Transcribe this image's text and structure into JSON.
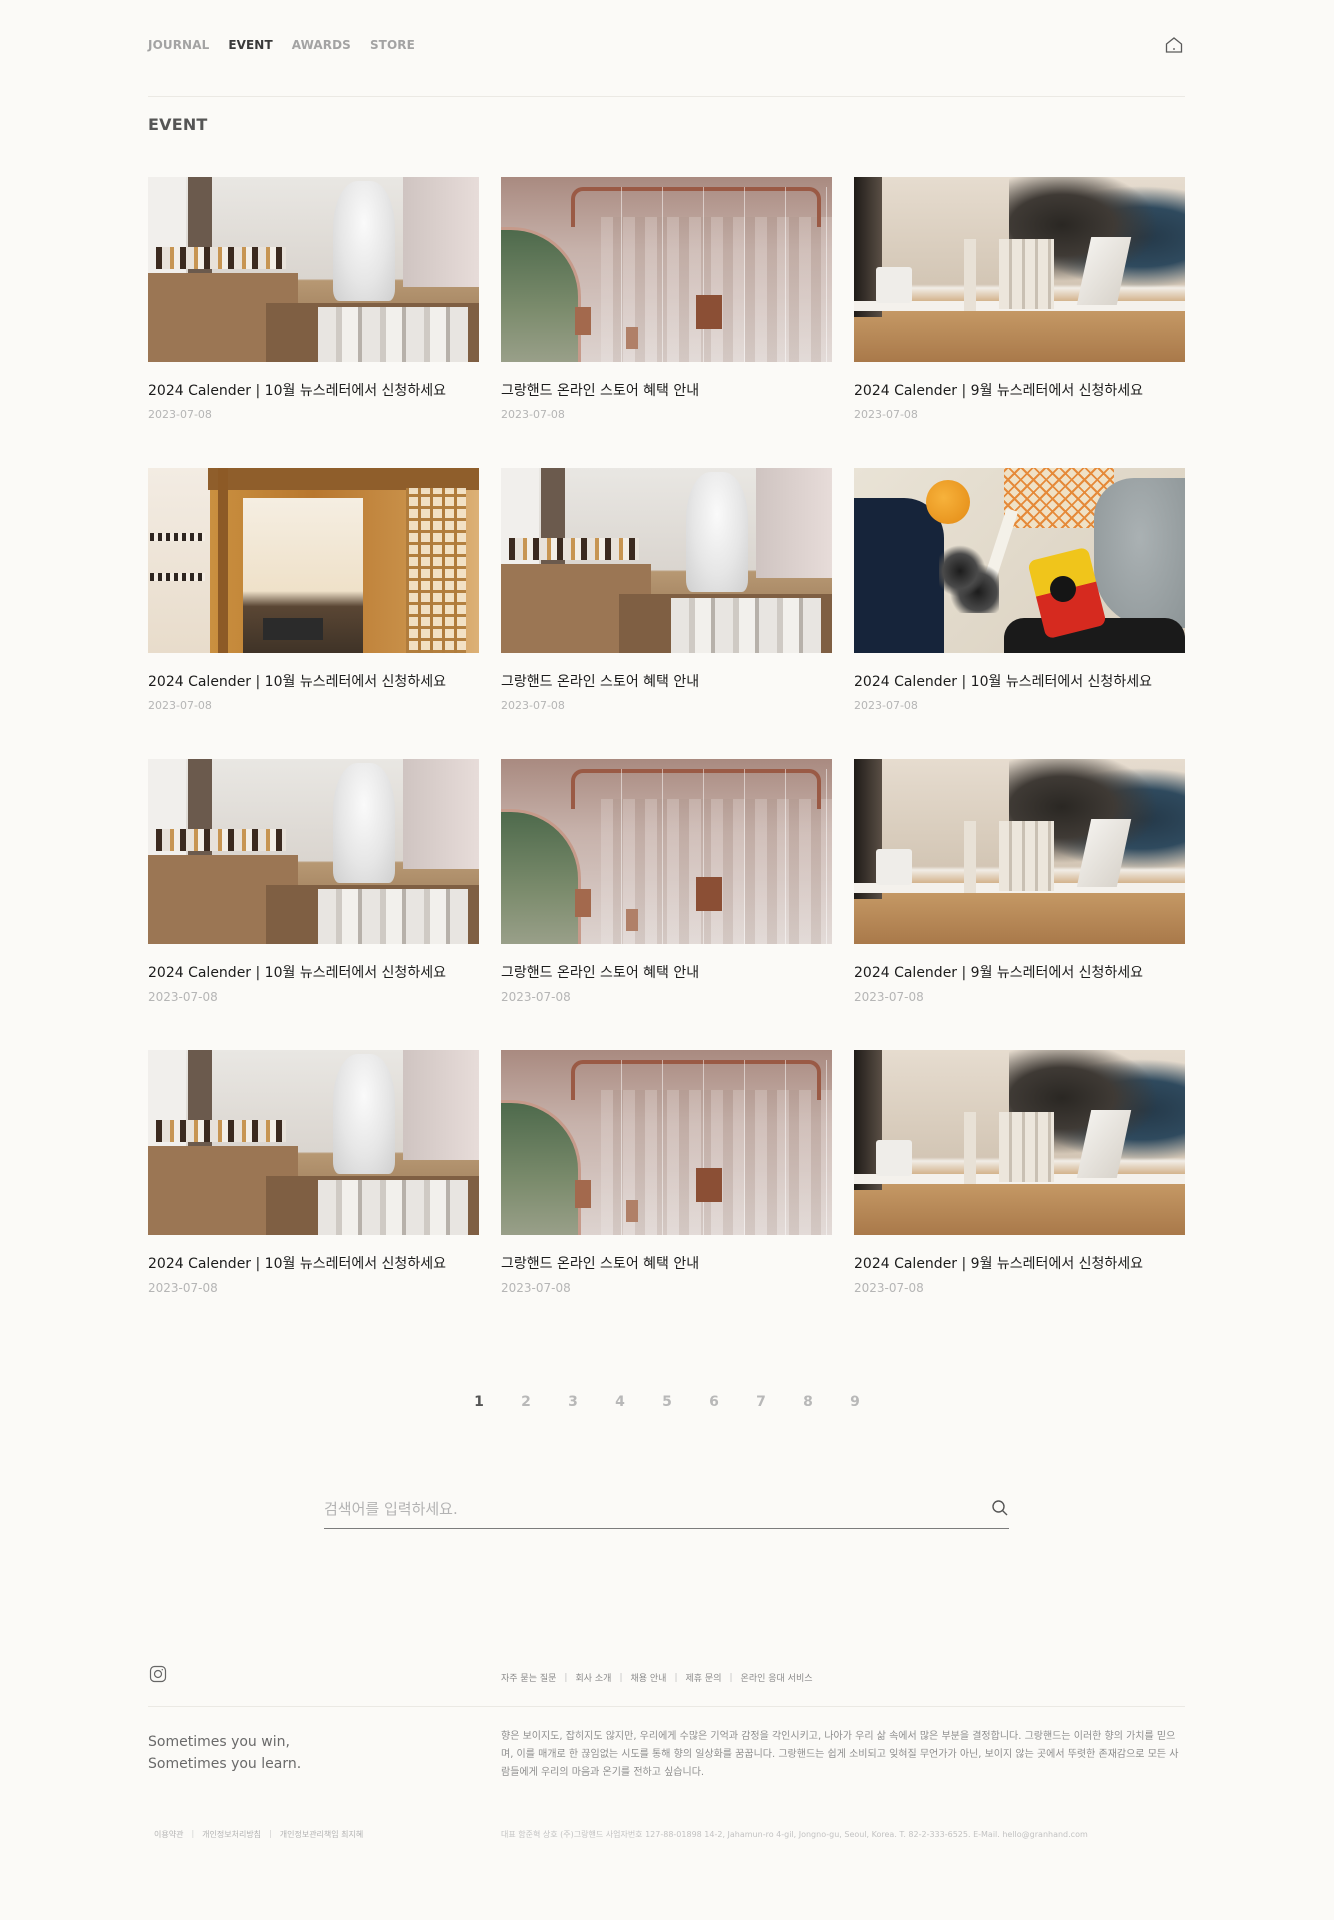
{
  "nav": {
    "items": [
      {
        "label": "JOURNAL",
        "active": false
      },
      {
        "label": "EVENT",
        "active": true
      },
      {
        "label": "AWARDS",
        "active": false
      },
      {
        "label": "STORE",
        "active": false
      }
    ],
    "home_icon": "home-icon"
  },
  "section": {
    "title": "EVENT"
  },
  "cards": [
    {
      "title": "2024 Calender  |  10월 뉴스레터에서 신청하세요",
      "date": "2023-07-08",
      "image": "shop-shelf-statue"
    },
    {
      "title": "그랑핸드 온라인 스토어 혜택 안내",
      "date": "2023-07-08",
      "image": "arch-window-hanging-tags"
    },
    {
      "title": "2024 Calender  |  9월 뉴스레터에서 신청하세요",
      "date": "2023-07-08",
      "image": "counter-products-people"
    },
    {
      "title": "2024 Calender  |  10월 뉴스레터에서 신청하세요",
      "date": "2023-07-08",
      "image": "hanok-store-interior"
    },
    {
      "title": "그랑핸드 온라인 스토어 혜택 안내",
      "date": "2023-07-08",
      "image": "shop-shelf-statue"
    },
    {
      "title": "2024 Calender  |  10월 뉴스레터에서 신청하세요",
      "date": "2023-07-08",
      "image": "flat-lay-bag-camera"
    },
    {
      "title": "2024 Calender  |  10월 뉴스레터에서 신청하세요",
      "date": "2023-07-08",
      "image": "shop-shelf-statue"
    },
    {
      "title": "그랑핸드 온라인 스토어 혜택 안내",
      "date": "2023-07-08",
      "image": "arch-window-hanging-tags"
    },
    {
      "title": "2024 Calender  |  9월 뉴스레터에서 신청하세요",
      "date": "2023-07-08",
      "image": "counter-products-people"
    },
    {
      "title": "2024 Calender  |  10월 뉴스레터에서 신청하세요",
      "date": "2023-07-08",
      "image": "shop-shelf-statue"
    },
    {
      "title": "그랑핸드 온라인 스토어 혜택 안내",
      "date": "2023-07-08",
      "image": "arch-window-hanging-tags"
    },
    {
      "title": "2024 Calender  |  9월 뉴스레터에서 신청하세요",
      "date": "2023-07-08",
      "image": "counter-products-people"
    }
  ],
  "pagination": {
    "pages": [
      "1",
      "2",
      "3",
      "4",
      "5",
      "6",
      "7",
      "8",
      "9"
    ],
    "current": "1"
  },
  "search": {
    "placeholder": "검색어를 입력하세요.",
    "value": "",
    "icon": "search-icon"
  },
  "footer": {
    "instagram_icon": "instagram-icon",
    "links": [
      "자주 묻는 질문",
      "회사 소개",
      "채용 안내",
      "제휴 문의",
      "온라인 응대 서비스"
    ],
    "slogan_line1": "Sometimes you win,",
    "slogan_line2": "Sometimes you learn.",
    "about": "향은 보이지도, 잡히지도 않지만, 우리에게 수많은 기억과 감정을 각인시키고, 나아가 우리 삶 속에서 많은 부분을 결정합니다. 그랑핸드는 이러한 향의 가치를 믿으며, 이를 매개로 한 끊임없는 시도를 통해 향의 일상화를 꿈꿉니다. 그랑핸드는 쉽게 소비되고 잊혀질 무언가가 아닌, 보이지 않는 곳에서 뚜렷한 존재감으로 모든 사람들에게 우리의 마음과 온기를 전하고 싶습니다.",
    "legal": [
      "이용약관",
      "개인정보처리방침",
      "개인정보관리책임 최지혜"
    ],
    "company": "대표 함준혁 상호 (주)그랑핸드 사업자번호 127-88-01898 14-2, Jahamun-ro 4-gil, Jongno-gu, Seoul, Korea. T. 82-2-333-6525. E-Mail. hello@granhand.com"
  }
}
